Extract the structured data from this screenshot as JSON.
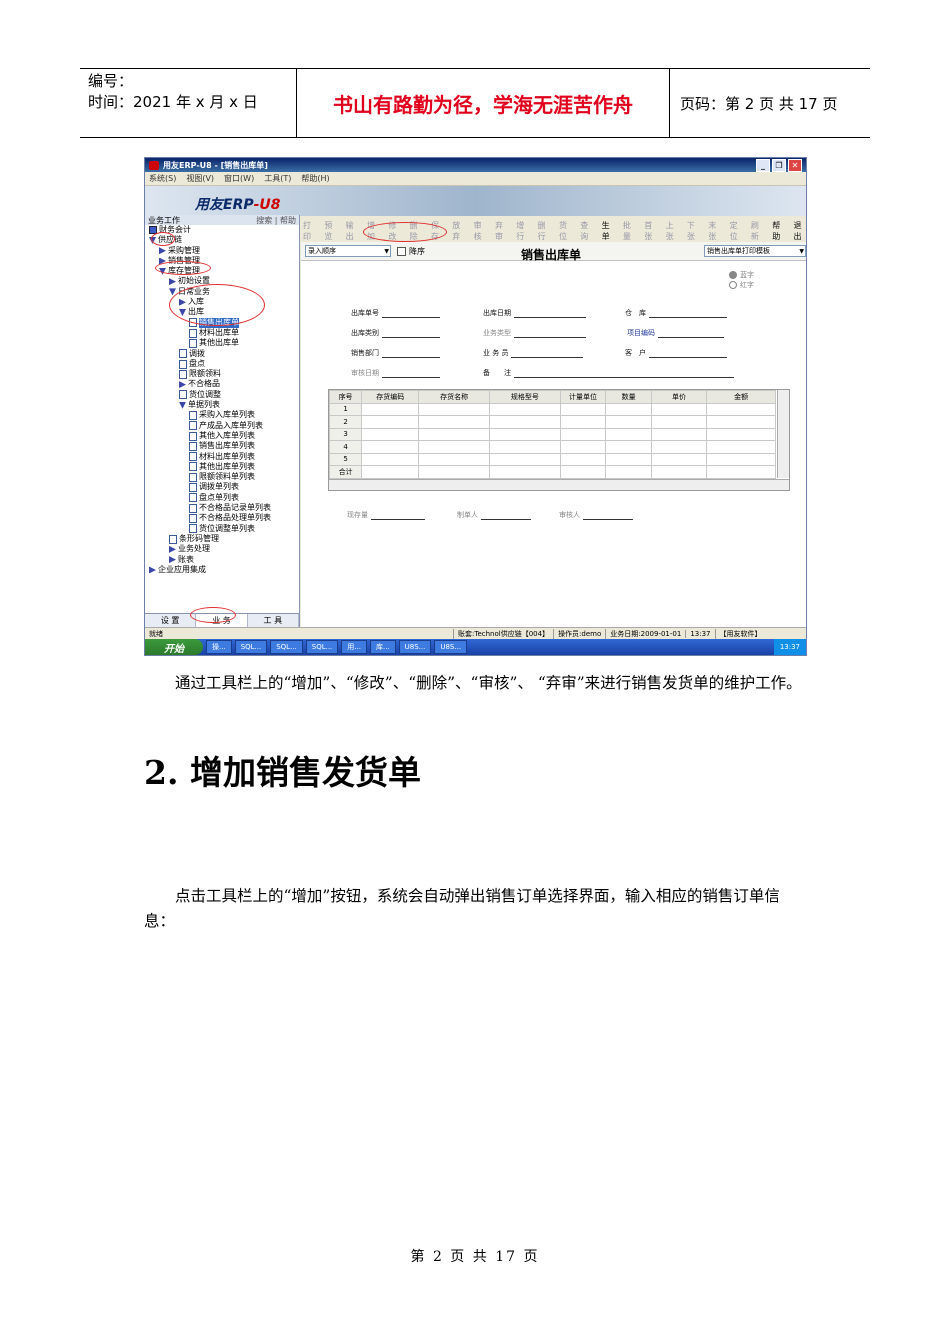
{
  "header": {
    "number_label": "编号：",
    "time_label": "时间：2021 年 x 月 x 日",
    "motto": "书山有路勤为径，学海无涯苦作舟",
    "page_label": "页码：第 2 页  共 17 页"
  },
  "screenshot": {
    "title": "用友ERP-U8 - [销售出库单]",
    "menu": [
      "系统(S)",
      "视图(V)",
      "窗口(W)",
      "工具(T)",
      "帮助(H)"
    ],
    "brand_prefix": "用友",
    "brand_mid": "ERP",
    "brand_suffix": "-U8",
    "left_header": "业务工作",
    "left_header_right": "搜索 | 帮助",
    "tree": [
      {
        "label": "财务会计",
        "icon": "node",
        "indent": 0
      },
      {
        "label": "供应链",
        "icon": "tri",
        "indent": 0
      },
      {
        "label": "采购管理",
        "icon": "arr",
        "indent": 1
      },
      {
        "label": "销售管理",
        "icon": "arr",
        "indent": 1
      },
      {
        "label": "库存管理",
        "icon": "tri",
        "indent": 1
      },
      {
        "label": "初始设置",
        "icon": "arr",
        "indent": 2
      },
      {
        "label": "日常业务",
        "icon": "tri",
        "indent": 2
      },
      {
        "label": "入库",
        "icon": "arr",
        "indent": 3
      },
      {
        "label": "出库",
        "icon": "tri",
        "indent": 3
      },
      {
        "label": "销售出库单",
        "icon": "doc",
        "indent": 4,
        "selected": true
      },
      {
        "label": "材料出库单",
        "icon": "doc",
        "indent": 4
      },
      {
        "label": "其他出库单",
        "icon": "doc",
        "indent": 4
      },
      {
        "label": "调拨",
        "icon": "doc",
        "indent": 3
      },
      {
        "label": "盘点",
        "icon": "doc",
        "indent": 3
      },
      {
        "label": "限额领料",
        "icon": "doc",
        "indent": 3
      },
      {
        "label": "不合格品",
        "icon": "arr",
        "indent": 3
      },
      {
        "label": "货位调整",
        "icon": "doc",
        "indent": 3
      },
      {
        "label": "单据列表",
        "icon": "tri",
        "indent": 3
      },
      {
        "label": "采购入库单列表",
        "icon": "doc",
        "indent": 4
      },
      {
        "label": "产成品入库单列表",
        "icon": "doc",
        "indent": 4
      },
      {
        "label": "其他入库单列表",
        "icon": "doc",
        "indent": 4
      },
      {
        "label": "销售出库单列表",
        "icon": "doc",
        "indent": 4
      },
      {
        "label": "材料出库单列表",
        "icon": "doc",
        "indent": 4
      },
      {
        "label": "其他出库单列表",
        "icon": "doc",
        "indent": 4
      },
      {
        "label": "限额领料单列表",
        "icon": "doc",
        "indent": 4
      },
      {
        "label": "调拨单列表",
        "icon": "doc",
        "indent": 4
      },
      {
        "label": "盘点单列表",
        "icon": "doc",
        "indent": 4
      },
      {
        "label": "不合格品记录单列表",
        "icon": "doc",
        "indent": 4
      },
      {
        "label": "不合格品处理单列表",
        "icon": "doc",
        "indent": 4
      },
      {
        "label": "货位调整单列表",
        "icon": "doc",
        "indent": 4
      },
      {
        "label": "条形码管理",
        "icon": "doc",
        "indent": 2
      },
      {
        "label": "业务处理",
        "icon": "arr",
        "indent": 2
      },
      {
        "label": "账表",
        "icon": "arr",
        "indent": 2
      },
      {
        "label": "企业应用集成",
        "icon": "arr",
        "indent": 0
      }
    ],
    "left_tabs": [
      "设 置",
      "业 务",
      "工 具"
    ],
    "toolbar": [
      "打印",
      "预览",
      "输出",
      "增加",
      "修改",
      "删除",
      "保存",
      "放弃",
      "审核",
      "弃审",
      "增行",
      "删行",
      "货位",
      "查询",
      "生单",
      "批量",
      "首张",
      "上张",
      "下张",
      "末张",
      "定位",
      "刷新",
      "帮助",
      "退出"
    ],
    "toolbar_active": [
      "生单",
      "帮助",
      "退出"
    ],
    "order_select": "录入顺序",
    "desc_label": "降序",
    "form_title": "销售出库单",
    "template_select": "销售出库单打印模板",
    "radio_blue": "蓝字",
    "radio_red": "红字",
    "fields": {
      "out_no": "出库单号",
      "out_date": "出库日期",
      "warehouse": "仓　库",
      "out_type": "出库类别",
      "biz_type": "业务类型",
      "project": "项目编码",
      "dept": "销售部门",
      "clerk": "业 务 员",
      "customer": "客　户",
      "audit_date": "审核日期",
      "remark": "备　　注"
    },
    "grid_headers": [
      "序号",
      "存货编码",
      "存货名称",
      "规格型号",
      "计量单位",
      "数量",
      "单价",
      "金额"
    ],
    "grid_rows": [
      "1",
      "2",
      "3",
      "4",
      "5"
    ],
    "grid_total": "合计",
    "bottom_fields": {
      "stock": "现存量",
      "maker": "制单人",
      "auditor": "审核人"
    },
    "status": {
      "ready": "就绪",
      "account": "账套:Technol供应链【004】",
      "operator": "操作员:demo",
      "biz_date": "业务日期:2009-01-01",
      "time": "13:37",
      "company": "【用友软件】"
    },
    "taskbar": {
      "start": "开始",
      "items": [
        "操...",
        "SQL...",
        "SQL...",
        "SQL...",
        "用...",
        "库...",
        "U8S...",
        "U8S..."
      ],
      "clock": "13:37"
    }
  },
  "para1": "通过工具栏上的“增加”、“修改”、“删除”、“审核”、 “弃审”来进行销售发货单的维护工作。",
  "heading": "2. 增加销售发货单",
  "para2": "点击工具栏上的“增加”按钮，系统会自动弹出销售订单选择界面，输入相应的销售订单信息：",
  "footer": "第 2 页 共 17 页"
}
